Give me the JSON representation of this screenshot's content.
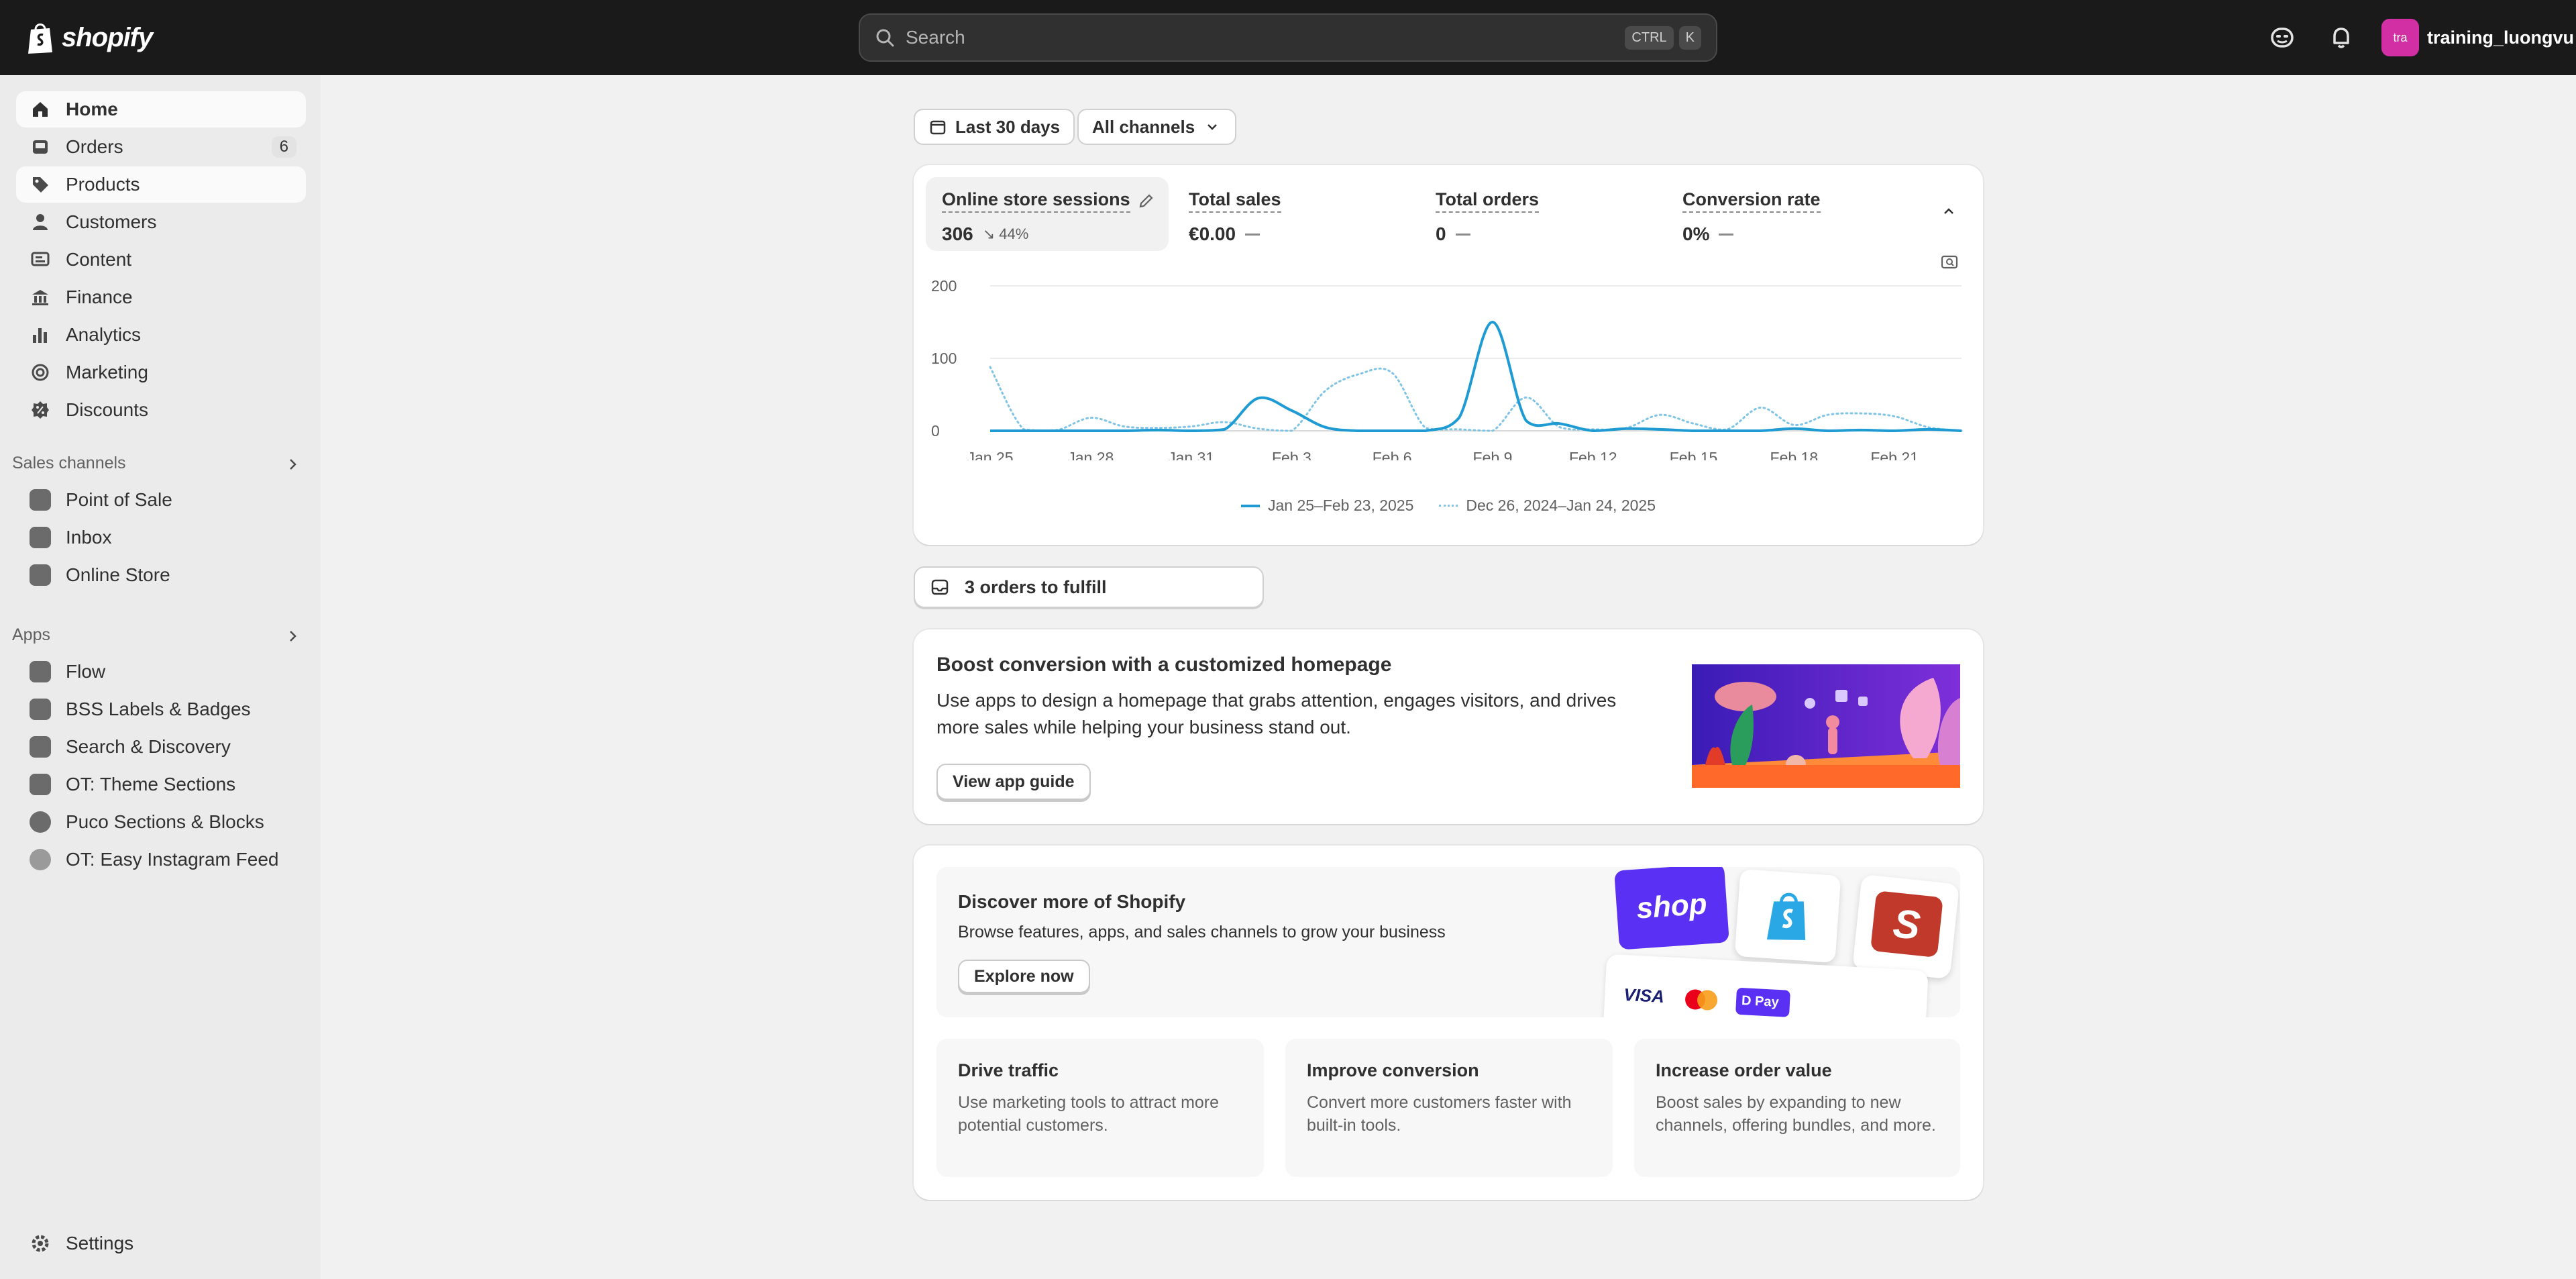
{
  "topbar": {
    "brand": "shopify",
    "search_placeholder": "Search",
    "shortcut_keys": [
      "CTRL",
      "K"
    ],
    "avatar_initials": "tra",
    "avatar_color": "#d12fa3",
    "user_name": "training_luongvu"
  },
  "sidebar": {
    "main_items": [
      {
        "label": "Home",
        "icon": "home-icon",
        "active": true
      },
      {
        "label": "Orders",
        "icon": "inbox-icon",
        "badge": "6"
      },
      {
        "label": "Products",
        "icon": "tag-icon"
      },
      {
        "label": "Customers",
        "icon": "person-icon"
      },
      {
        "label": "Content",
        "icon": "content-icon"
      },
      {
        "label": "Finance",
        "icon": "bank-icon"
      },
      {
        "label": "Analytics",
        "icon": "bar-chart-icon"
      },
      {
        "label": "Marketing",
        "icon": "target-icon"
      },
      {
        "label": "Discounts",
        "icon": "discount-icon"
      }
    ],
    "sales_channels_title": "Sales channels",
    "sales_channels": [
      {
        "label": "Point of Sale",
        "icon": "pos-icon"
      },
      {
        "label": "Inbox",
        "icon": "inbox-app-icon"
      },
      {
        "label": "Online Store",
        "icon": "store-icon"
      }
    ],
    "apps_title": "Apps",
    "apps": [
      {
        "label": "Flow",
        "icon": "flow-icon"
      },
      {
        "label": "BSS Labels & Badges",
        "icon": "bss-icon"
      },
      {
        "label": "Search & Discovery",
        "icon": "search-discovery-icon"
      },
      {
        "label": "OT: Theme Sections",
        "icon": "ot-theme-icon"
      },
      {
        "label": "Puco Sections & Blocks",
        "icon": "puco-icon"
      },
      {
        "label": "OT: Easy Instagram Feed",
        "icon": "instagram-feed-icon"
      }
    ],
    "settings_label": "Settings"
  },
  "filters": {
    "date_range": "Last 30 days",
    "channels": "All channels"
  },
  "metrics": [
    {
      "label": "Online store sessions",
      "value": "306",
      "change": "44%",
      "selected": true
    },
    {
      "label": "Total sales",
      "value": "€0.00"
    },
    {
      "label": "Total orders",
      "value": "0"
    },
    {
      "label": "Conversion rate",
      "value": "0%"
    }
  ],
  "chart_data": {
    "type": "line",
    "x": [
      "Jan 25",
      "Jan 26",
      "Jan 27",
      "Jan 28",
      "Jan 29",
      "Jan 30",
      "Jan 31",
      "Feb 1",
      "Feb 2",
      "Feb 3",
      "Feb 4",
      "Feb 5",
      "Feb 6",
      "Feb 7",
      "Feb 8",
      "Feb 9",
      "Feb 10",
      "Feb 11",
      "Feb 12",
      "Feb 13",
      "Feb 14",
      "Feb 15",
      "Feb 16",
      "Feb 17",
      "Feb 18",
      "Feb 19",
      "Feb 20",
      "Feb 21",
      "Feb 22",
      "Feb 23"
    ],
    "tick_labels": [
      "Jan 25",
      "Jan 28",
      "Jan 31",
      "Feb 3",
      "Feb 6",
      "Feb 9",
      "Feb 12",
      "Feb 15",
      "Feb 18",
      "Feb 21"
    ],
    "yticks": [
      0,
      100,
      200
    ],
    "ylim": [
      0,
      200
    ],
    "series": [
      {
        "name": "Jan 25–Feb 23, 2025",
        "style": "solid",
        "color": "#1f9bd3",
        "values": [
          0,
          0,
          0,
          0,
          0,
          1,
          0,
          2,
          45,
          28,
          5,
          0,
          0,
          0,
          18,
          150,
          14,
          10,
          0,
          3,
          2,
          0,
          0,
          0,
          3,
          0,
          1,
          0,
          2,
          0
        ]
      },
      {
        "name": "Dec 26, 2024–Jan 24, 2025",
        "style": "dotted",
        "color": "#7fc4e4",
        "values": [
          88,
          2,
          1,
          18,
          6,
          4,
          6,
          12,
          3,
          0,
          55,
          78,
          80,
          4,
          2,
          0,
          46,
          5,
          2,
          4,
          22,
          10,
          2,
          32,
          8,
          22,
          24,
          20,
          5,
          0
        ]
      }
    ],
    "grid": true,
    "legend": "bottom-center"
  },
  "orders_to_fulfill": "3 orders to fulfill",
  "boost_card": {
    "title": "Boost conversion with a customized homepage",
    "body": "Use apps to design a homepage that grabs attention, engages visitors, and drives more sales while helping your business stand out.",
    "button": "View app guide"
  },
  "discover": {
    "title": "Discover more of Shopify",
    "body": "Browse features, apps, and sales channels to grow your business",
    "button": "Explore now",
    "shop_label": "shop",
    "visa_label": "VISA",
    "pay_label": "D Pay"
  },
  "tiles": [
    {
      "title": "Drive traffic",
      "body": "Use marketing tools to attract more potential customers."
    },
    {
      "title": "Improve conversion",
      "body": "Convert more customers faster with built-in tools."
    },
    {
      "title": "Increase order value",
      "body": "Boost sales by expanding to new channels, offering bundles, and more."
    }
  ],
  "colors": {
    "topbar": "#1a1a1a",
    "accent_line": "#1f9bd3",
    "sidebar": "#ebebeb",
    "background": "#f1f1f1"
  }
}
